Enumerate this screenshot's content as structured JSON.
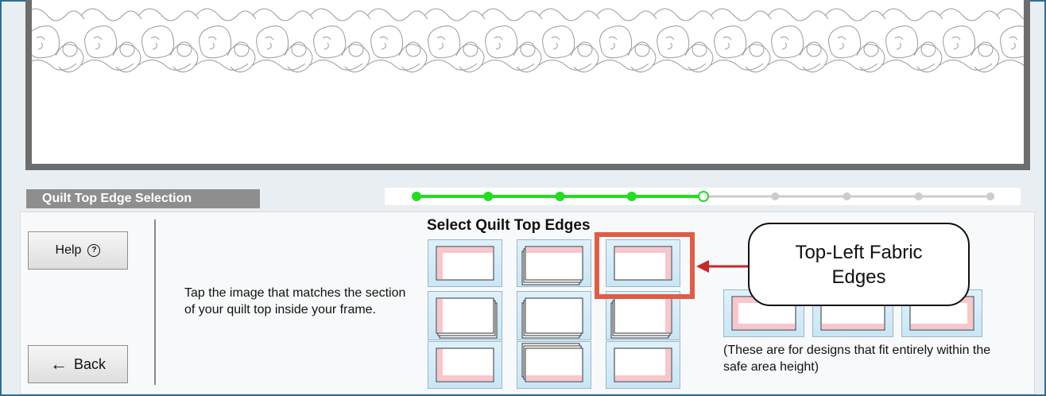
{
  "section": {
    "label": "Quilt Top Edge Selection"
  },
  "progress": {
    "total_steps": 9,
    "completed_steps": 4,
    "current_step": 5,
    "active_color": "#22dd22",
    "inactive_color": "#cccccc"
  },
  "buttons": {
    "help_label": "Help",
    "back_label": "Back"
  },
  "icons": {
    "help": "?",
    "back": "←"
  },
  "instruction": "Tap the image that matches the section of your quilt top inside your frame.",
  "grid": {
    "title": "Select Quilt Top Edges",
    "selected": "top-left",
    "options": [
      "top-left",
      "top",
      "top-right",
      "left",
      "center",
      "right",
      "bottom-left",
      "bottom",
      "bottom-right"
    ]
  },
  "extra_options": [
    "top-left-bottom",
    "top-bottom",
    "top-right-bottom"
  ],
  "callout": {
    "line1": "Top-Left Fabric",
    "line2": "Edges"
  },
  "note": "(These are for designs that fit entirely within the safe area height)",
  "colors": {
    "highlight": "#e05c45",
    "arrow": "#c62828",
    "fabric": "#f8c6cc",
    "button_bg": "#d6edf8"
  }
}
